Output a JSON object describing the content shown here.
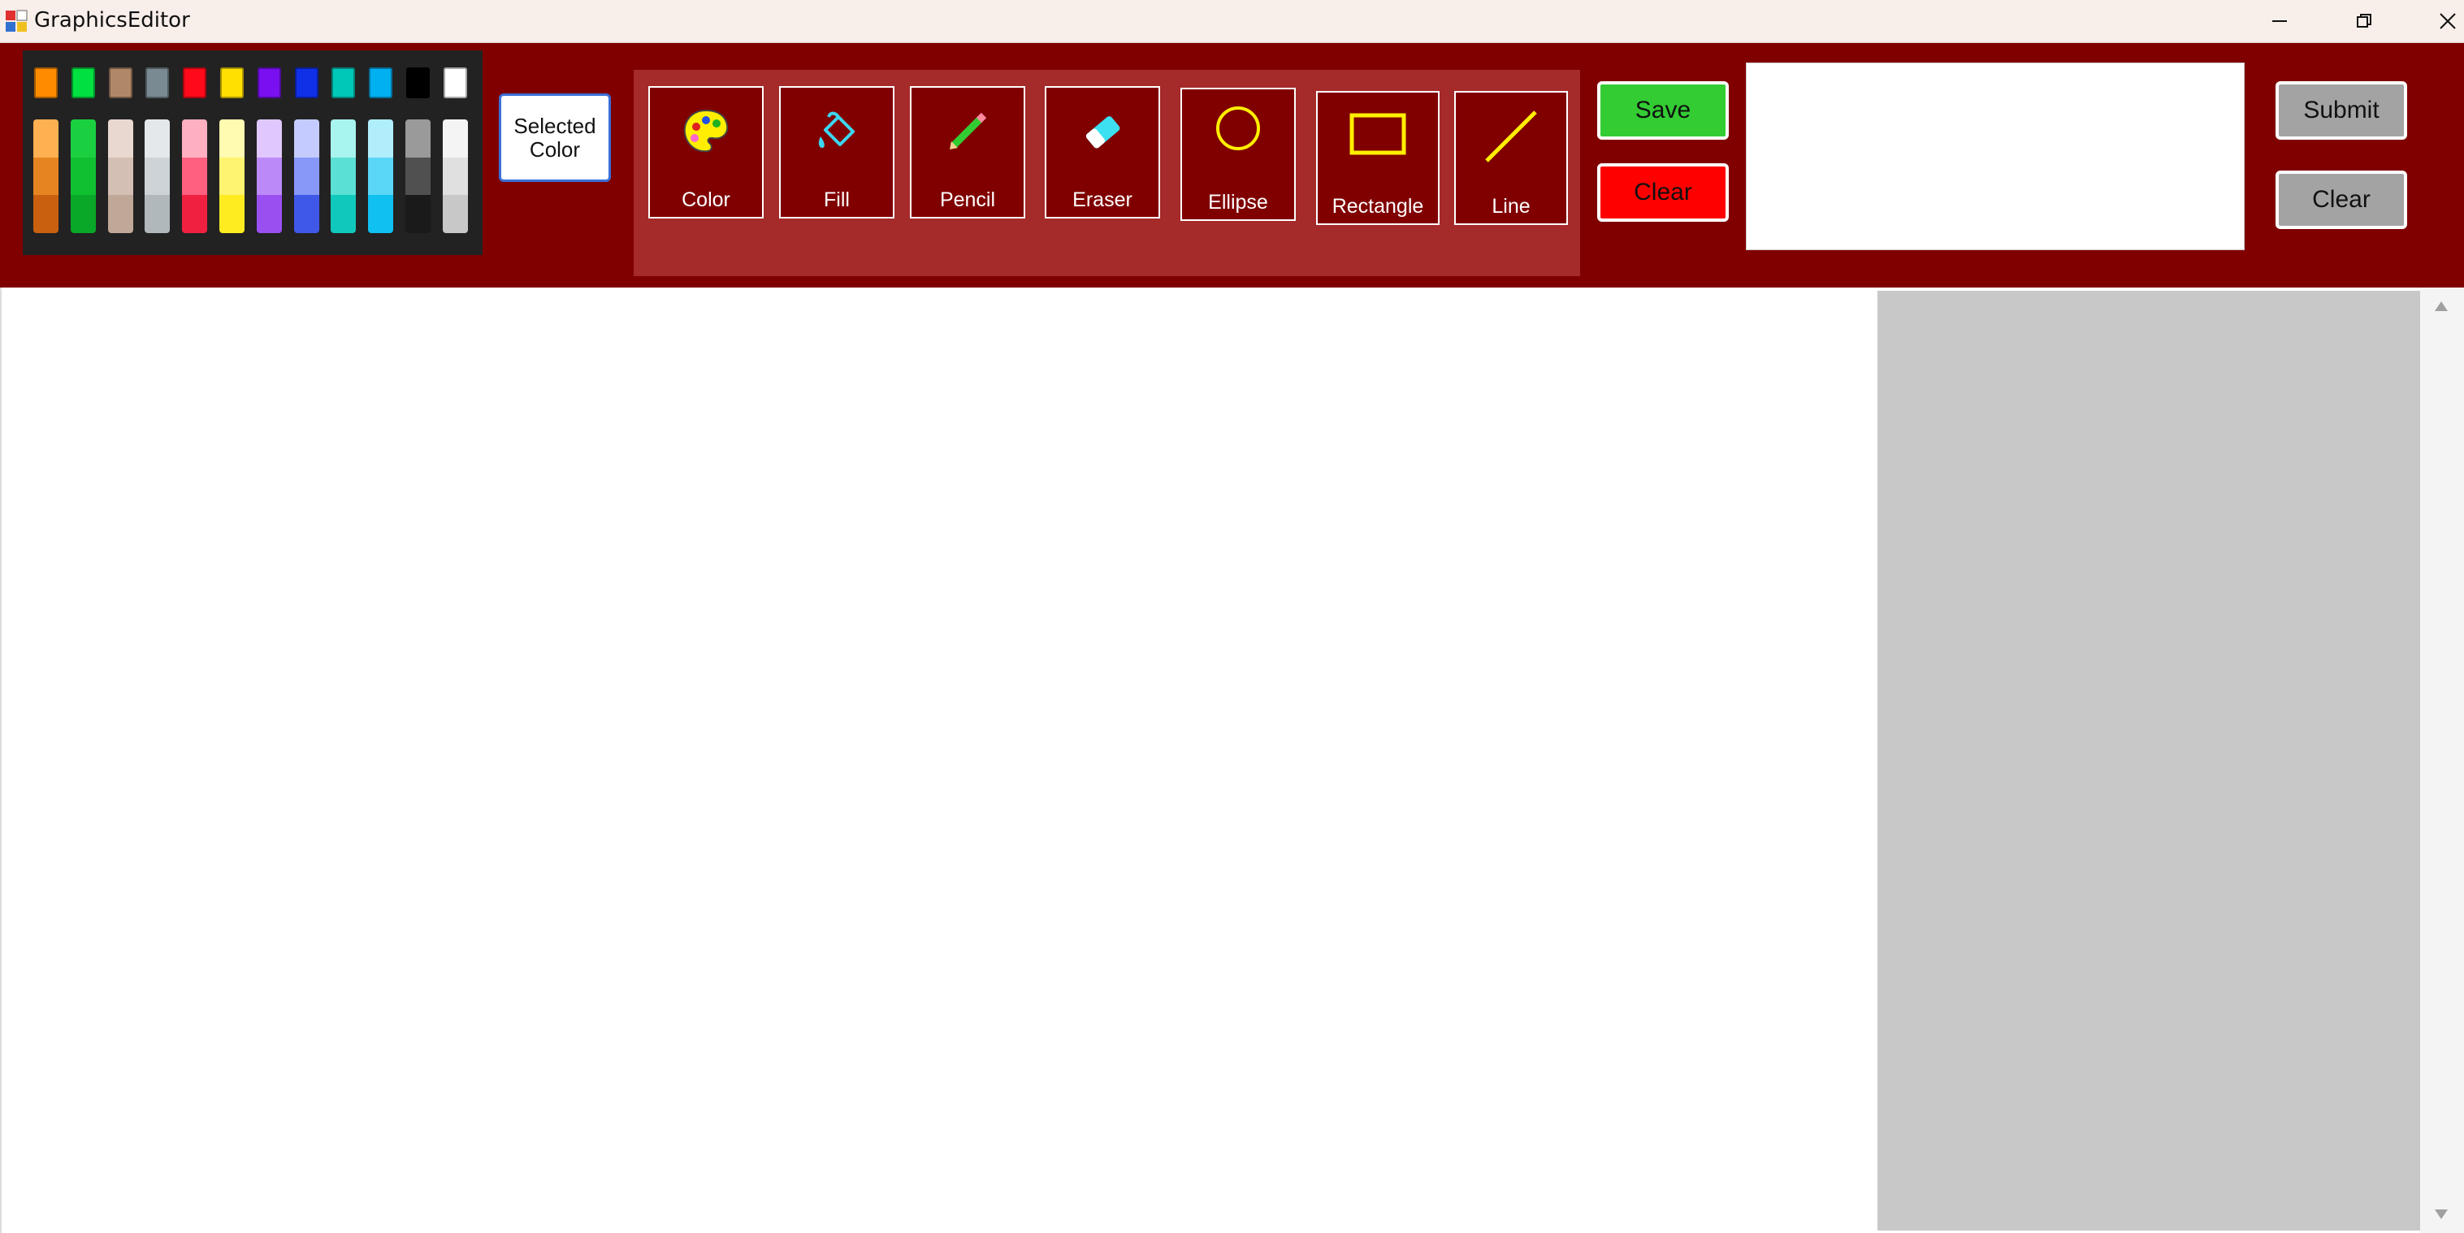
{
  "window": {
    "title": "GraphicsEditor",
    "icon": "app-grid-icon",
    "controls": [
      "minimize-icon",
      "restore-icon",
      "close-icon"
    ]
  },
  "palette": {
    "top_colors": [
      "#ff8c00",
      "#00e040",
      "#b08868",
      "#7a8a92",
      "#ff0a1a",
      "#ffe000",
      "#7a10f0",
      "#1030e8",
      "#00c8b8",
      "#00b0f0",
      "#000000",
      "#ffffff"
    ],
    "shade_columns": [
      [
        "#ffb050",
        "#e58420",
        "#c86010"
      ],
      [
        "#1bd040",
        "#10c030",
        "#0aa828"
      ],
      [
        "#e8d8d0",
        "#d4bfb4",
        "#c0a898"
      ],
      [
        "#e4e8ea",
        "#cdd3d6",
        "#b0b8bc"
      ],
      [
        "#ffb0c0",
        "#ff6080",
        "#f02040"
      ],
      [
        "#fffbb0",
        "#fff470",
        "#ffec20"
      ],
      [
        "#e0c8ff",
        "#bc8af8",
        "#9a50f0"
      ],
      [
        "#c4ccff",
        "#8898f8",
        "#4058e8"
      ],
      [
        "#a8f4ee",
        "#5ae0d4",
        "#10c8bc"
      ],
      [
        "#b0eefc",
        "#5ad6f6",
        "#10c0f0"
      ],
      [
        "#9a9a9a",
        "#505050",
        "#1a1a1a"
      ],
      [
        "#f4f4f4",
        "#e0e0e0",
        "#c8c8c8"
      ]
    ]
  },
  "selected_color": {
    "label": "Selected\nColor",
    "value": "#ffffff"
  },
  "tools": [
    {
      "id": "color",
      "label": "Color",
      "icon": "palette-icon"
    },
    {
      "id": "fill",
      "label": "Fill",
      "icon": "paint-bucket-icon"
    },
    {
      "id": "pencil",
      "label": "Pencil",
      "icon": "pencil-icon"
    },
    {
      "id": "eraser",
      "label": "Eraser",
      "icon": "eraser-icon"
    },
    {
      "id": "ellipse",
      "label": "Ellipse",
      "icon": "ellipse-icon"
    },
    {
      "id": "rectangle",
      "label": "Rectangle",
      "icon": "rectangle-icon"
    },
    {
      "id": "line",
      "label": "Line",
      "icon": "line-icon"
    }
  ],
  "actions": {
    "save_label": "Save",
    "save_color": "#33cc33",
    "clear_label": "Clear",
    "clear_color": "#ff0000"
  },
  "text_box": {
    "value": ""
  },
  "side_actions": {
    "submit_label": "Submit",
    "clear_label": "Clear"
  },
  "colors": {
    "toolbar_bg": "#800000",
    "tools_panel_bg": "#a52a2a",
    "side_panel_bg": "#c8c8c8",
    "tool_icon_yellow": "#ffee00"
  }
}
